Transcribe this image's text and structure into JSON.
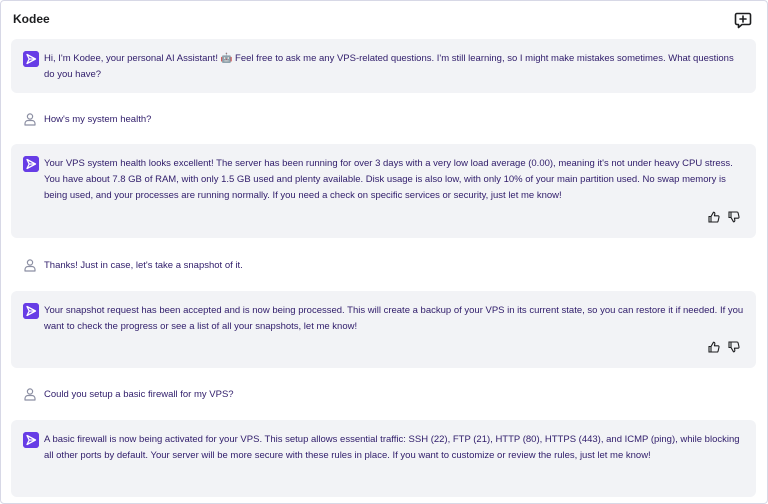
{
  "header": {
    "title": "Kodee",
    "new_chat_icon": "chat-plus-icon"
  },
  "colors": {
    "brand": "#673de6",
    "bot_bubble": "#f2f3f6",
    "text": "#2f1c6a"
  },
  "messages": [
    {
      "role": "assistant",
      "text": "Hi, I'm Kodee, your personal AI Assistant! 🤖 Feel free to ask me any VPS-related questions. I'm still learning, so I might make mistakes sometimes. What questions do you have?",
      "feedback": false
    },
    {
      "role": "user",
      "text": "How's my system health?"
    },
    {
      "role": "assistant",
      "text": "Your VPS system health looks excellent! The server has been running for over 3 days with a very low load average (0.00), meaning it's not under heavy CPU stress. You have about 7.8 GB of RAM, with only 1.5 GB used and plenty available. Disk usage is also low, with only 10% of your main partition used. No swap memory is being used, and your processes are running normally. If you need a check on specific services or security, just let me know!",
      "feedback": true
    },
    {
      "role": "user",
      "text": "Thanks! Just in case, let's take a snapshot of it."
    },
    {
      "role": "assistant",
      "text": "Your snapshot request has been accepted and is now being processed. This will create a backup of your VPS in its current state, so you can restore it if needed. If you want to check the progress or see a list of all your snapshots, let me know!",
      "feedback": true
    },
    {
      "role": "user",
      "text": "Could you setup a basic firewall for my VPS?"
    },
    {
      "role": "assistant",
      "text": "A basic firewall is now being activated for your VPS. This setup allows essential traffic: SSH (22), FTP (21), HTTP (80), HTTPS (443), and ICMP (ping), while blocking all other ports by default. Your server will be more secure with these rules in place. If you want to customize or review the rules, just let me know!",
      "feedback": false
    }
  ]
}
